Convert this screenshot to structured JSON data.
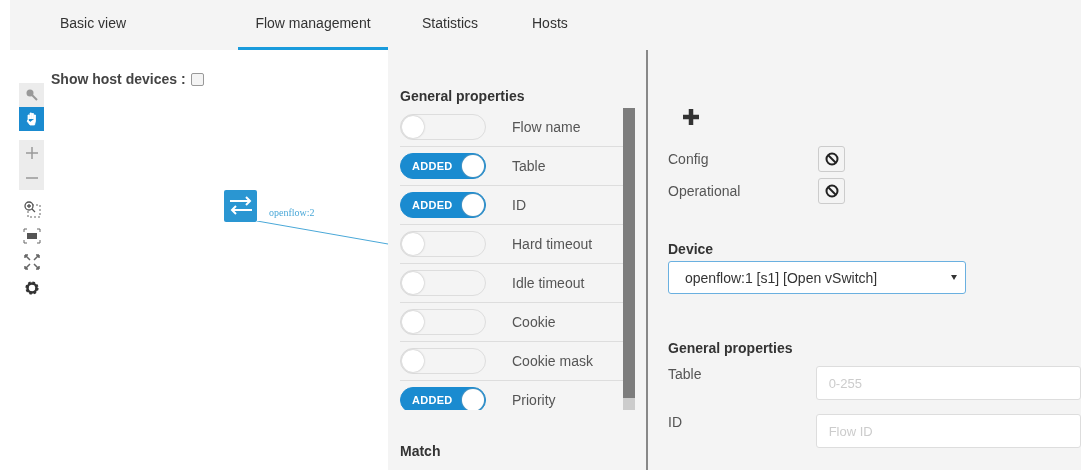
{
  "tabs": [
    {
      "label": "Basic view",
      "selected": false
    },
    {
      "label": "Flow management",
      "selected": true
    },
    {
      "label": "Statistics",
      "selected": false
    },
    {
      "label": "Hosts",
      "selected": false
    }
  ],
  "canvas": {
    "show_hosts_label": "Show host devices :",
    "show_hosts_checked": false,
    "tools": [
      {
        "kind": "select",
        "selected": false
      },
      {
        "kind": "pan",
        "selected": true
      }
    ],
    "node": {
      "label": "openflow:2"
    }
  },
  "flow_properties": {
    "title": "General properties",
    "items": [
      {
        "label": "Flow name",
        "added": false
      },
      {
        "label": "Table",
        "added": true,
        "badge": "ADDED"
      },
      {
        "label": "ID",
        "added": true,
        "badge": "ADDED"
      },
      {
        "label": "Hard timeout",
        "added": false
      },
      {
        "label": "Idle timeout",
        "added": false
      },
      {
        "label": "Cookie",
        "added": false
      },
      {
        "label": "Cookie mask",
        "added": false
      },
      {
        "label": "Priority",
        "added": true,
        "badge": "ADDED"
      }
    ],
    "match_title": "Match"
  },
  "editor": {
    "stores": [
      {
        "label": "Config"
      },
      {
        "label": "Operational"
      }
    ],
    "device": {
      "label": "Device",
      "value": "openflow:1 [s1] [Open vSwitch]"
    },
    "general": {
      "title": "General properties",
      "fields": [
        {
          "label": "Table",
          "placeholder": "0-255"
        },
        {
          "label": "ID",
          "placeholder": "Flow ID"
        }
      ]
    }
  }
}
